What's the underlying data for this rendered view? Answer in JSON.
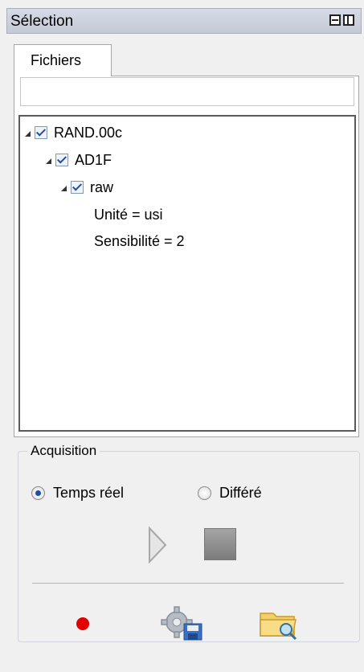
{
  "panel": {
    "title": "Sélection",
    "icons": [
      "minimize-icon",
      "float-icon"
    ]
  },
  "tabs": [
    {
      "label": "Fichiers"
    }
  ],
  "filter": {
    "value": "",
    "placeholder": ""
  },
  "tree": {
    "root": {
      "label": "RAND.00c",
      "checked": true
    },
    "child": {
      "label": "AD1F",
      "checked": true
    },
    "grandchild": {
      "label": "raw",
      "checked": true
    },
    "props": [
      "Unité = usi",
      "Sensibilité = 2"
    ]
  },
  "acquisition": {
    "label": "Acquisition",
    "options": [
      {
        "label": "Temps réel",
        "selected": true
      },
      {
        "label": "Différé",
        "selected": false
      }
    ]
  },
  "colors": {
    "record": "#e00000",
    "accent": "#1f4fa0"
  }
}
